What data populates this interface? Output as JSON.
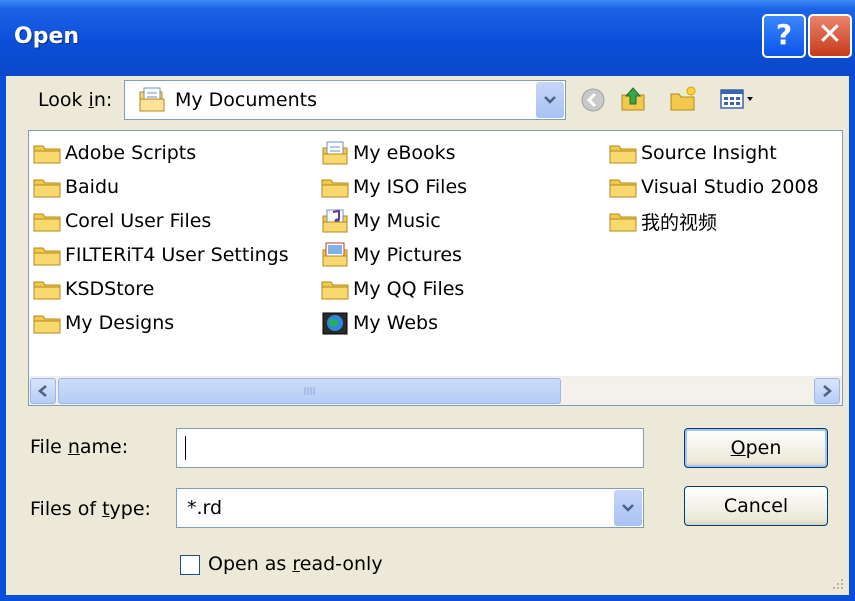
{
  "window": {
    "title": "Open"
  },
  "titlebar": {
    "help_glyph": "?",
    "close_glyph": "✕"
  },
  "lookin": {
    "label_pre": "Look ",
    "label_accel": "i",
    "label_post": "n:",
    "value": "My Documents",
    "value_icon": "my-documents-icon"
  },
  "toolbar": {
    "back_icon": "back-arrow-icon",
    "up_icon": "up-folder-icon",
    "new_folder_icon": "new-folder-icon",
    "views_icon": "views-menu-icon"
  },
  "files": {
    "columns": [
      [
        {
          "name": "Adobe Scripts",
          "icon": "folder-icon"
        },
        {
          "name": "Baidu",
          "icon": "folder-icon"
        },
        {
          "name": "Corel User Files",
          "icon": "folder-icon"
        },
        {
          "name": "FILTERiT4 User Settings",
          "icon": "folder-icon"
        },
        {
          "name": "KSDStore",
          "icon": "folder-icon"
        },
        {
          "name": "My Designs",
          "icon": "folder-icon"
        }
      ],
      [
        {
          "name": "My eBooks",
          "icon": "ebooks-folder-icon"
        },
        {
          "name": "My ISO Files",
          "icon": "folder-icon"
        },
        {
          "name": "My Music",
          "icon": "music-folder-icon"
        },
        {
          "name": "My Pictures",
          "icon": "pictures-folder-icon"
        },
        {
          "name": "My QQ Files",
          "icon": "folder-icon"
        },
        {
          "name": "My Webs",
          "icon": "webs-folder-icon"
        }
      ],
      [
        {
          "name": "Source Insight",
          "icon": "folder-icon"
        },
        {
          "name": "Visual Studio 2008",
          "icon": "folder-icon"
        },
        {
          "name": "我的视频",
          "icon": "folder-icon"
        }
      ]
    ]
  },
  "filename": {
    "label_pre": "File ",
    "label_accel": "n",
    "label_post": "ame:",
    "value": ""
  },
  "filetype": {
    "label_pre": "Files of ",
    "label_accel": "t",
    "label_post": "ype:",
    "value": "*.rd"
  },
  "buttons": {
    "open_accel": "O",
    "open_rest": "pen",
    "cancel": "Cancel"
  },
  "readonly": {
    "label_pre": "Open as ",
    "label_accel": "r",
    "label_post": "ead-only",
    "checked": false
  },
  "colors": {
    "titlebar": "#0a4fd9",
    "face": "#ece9d8",
    "close": "#c8391c",
    "folder": "#f2c94c"
  }
}
